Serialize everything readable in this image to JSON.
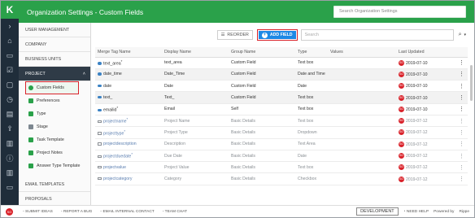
{
  "header": {
    "title": "Organization Settings - Custom Fields",
    "search_placeholder": "Search Organization Settings"
  },
  "rail": {
    "logo": "K",
    "icons": [
      "arrow-right-icon",
      "home-icon",
      "folder-icon",
      "task-icon",
      "chat-icon",
      "timesheet-icon",
      "document-icon",
      "export-icon",
      "report-icon",
      "help-icon",
      "report-icon",
      "folder-icon"
    ]
  },
  "sidebar": {
    "sections_top": [
      "USER MANAGEMENT",
      "COMPANY",
      "BUSINESS UNITS"
    ],
    "project_label": "PROJECT",
    "project_items": [
      {
        "label": "Custom Fields",
        "icon": "dot"
      },
      {
        "label": "Preferences",
        "icon": "green"
      },
      {
        "label": "Type",
        "icon": "green"
      },
      {
        "label": "Stage",
        "icon": "gray"
      },
      {
        "label": "Task Template",
        "icon": "green"
      },
      {
        "label": "Project Notes",
        "icon": "green"
      },
      {
        "label": "Answer Type Template",
        "icon": "green"
      }
    ],
    "sections_bottom": [
      "EMAIL TEMPLATES",
      "PROPOSALS"
    ]
  },
  "toolbar": {
    "reorder_label": "REORDER",
    "add_field_label": "ADD FIELD",
    "search_placeholder": "Search"
  },
  "table": {
    "columns": [
      "Merge Tag Name",
      "Display Name",
      "Group Name",
      "Type",
      "Values",
      "Last Updated"
    ],
    "rows": [
      {
        "tag": "text_area",
        "req": true,
        "display": "text_area",
        "group": "Custom Field",
        "type": "Text box",
        "values": "",
        "avatar": "SG",
        "updated": "2019-07-10",
        "kind": "custom"
      },
      {
        "tag": "date_time",
        "req": false,
        "display": "Date_Time",
        "group": "Custom Field",
        "type": "Date and Time",
        "values": "",
        "avatar": "SG",
        "updated": "2019-07-10",
        "kind": "custom"
      },
      {
        "tag": "date",
        "req": false,
        "display": "Date",
        "group": "Custom Field",
        "type": "Date",
        "values": "",
        "avatar": "SG",
        "updated": "2019-07-10",
        "kind": "custom"
      },
      {
        "tag": "text_",
        "req": false,
        "display": "Text_",
        "group": "Custom Field",
        "type": "Text box",
        "values": "",
        "avatar": "SG",
        "updated": "2019-07-10",
        "kind": "custom"
      },
      {
        "tag": "emailid",
        "req": true,
        "display": "Email",
        "group": "Self",
        "type": "Text box",
        "values": "",
        "avatar": "SG",
        "updated": "2019-07-10",
        "kind": "custom"
      },
      {
        "tag": "projectname",
        "req": true,
        "display": "Project Name",
        "group": "Basic Details",
        "type": "Text box",
        "values": "",
        "avatar": "SG",
        "updated": "2019-07-12",
        "kind": "sys"
      },
      {
        "tag": "projecttype",
        "req": true,
        "display": "Project Type",
        "group": "Basic Details",
        "type": "Dropdown",
        "values": "",
        "avatar": "SG",
        "updated": "2019-07-12",
        "kind": "sys"
      },
      {
        "tag": "projectdescription",
        "req": false,
        "display": "Description",
        "group": "Basic Details",
        "type": "Text Area",
        "values": "",
        "avatar": "SG",
        "updated": "2019-07-12",
        "kind": "sys"
      },
      {
        "tag": "projectduedate",
        "req": true,
        "display": "Due Date",
        "group": "Basic Details",
        "type": "Date",
        "values": "",
        "avatar": "SG",
        "updated": "2019-07-12",
        "kind": "sys"
      },
      {
        "tag": "projectvalue",
        "req": false,
        "display": "Project Value",
        "group": "Basic Details",
        "type": "Text box",
        "values": "",
        "avatar": "SG",
        "updated": "2019-07-12",
        "kind": "sys"
      },
      {
        "tag": "projectcategory",
        "req": false,
        "display": "Category",
        "group": "Basic Details",
        "type": "Checkbox",
        "values": "",
        "avatar": "SG",
        "updated": "2019-07-12",
        "kind": "sys"
      }
    ]
  },
  "footer": {
    "avatar": "SG",
    "links": [
      "SUBMIT IDEAS",
      "REPORT A BUG",
      "EMAIL INTERNAL CONTACT",
      "TEAM CHAT"
    ],
    "env": "DEVELOPMENT",
    "help": "NEED HELP",
    "powered": "Powered by",
    "brand": "Rippe"
  }
}
